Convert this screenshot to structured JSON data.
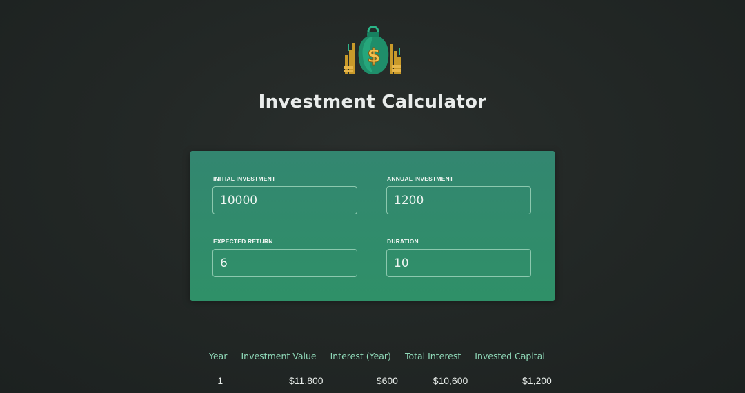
{
  "app": {
    "title": "Investment Calculator",
    "logo_icon": "money-bag-icon",
    "accent_color": "#2f8f6c",
    "header_text_color": "#8fd9b8"
  },
  "inputs": {
    "initial_investment": {
      "label": "INITIAL INVESTMENT",
      "value": "10000"
    },
    "annual_investment": {
      "label": "ANNUAL INVESTMENT",
      "value": "1200"
    },
    "expected_return": {
      "label": "EXPECTED RETURN",
      "value": "6"
    },
    "duration": {
      "label": "DURATION",
      "value": "10"
    }
  },
  "results": {
    "headers": [
      "Year",
      "Investment Value",
      "Interest (Year)",
      "Total Interest",
      "Invested Capital"
    ],
    "rows": [
      [
        "1",
        "$11,800",
        "$600",
        "$10,600",
        "$1,200"
      ]
    ]
  }
}
